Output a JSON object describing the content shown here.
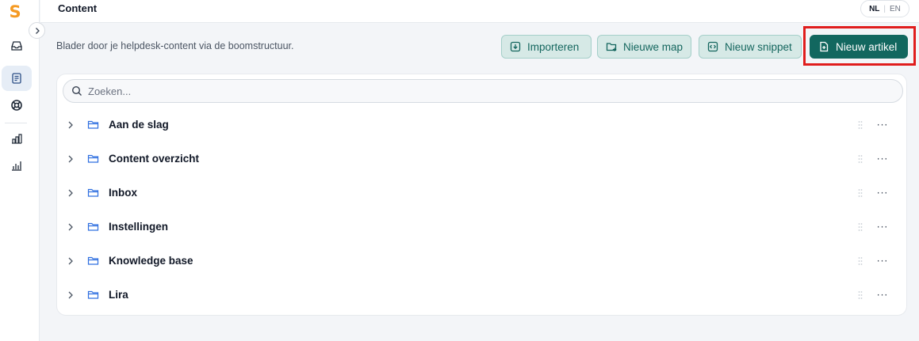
{
  "app": {
    "logo_letter": "S"
  },
  "sidebar": {
    "items": [
      {
        "name": "inbox",
        "icon": "inbox-icon"
      },
      {
        "name": "content",
        "icon": "document-icon",
        "active": true
      },
      {
        "name": "support",
        "icon": "lifebuoy-icon"
      },
      {
        "name": "reports",
        "icon": "building-chart-icon"
      },
      {
        "name": "analytics",
        "icon": "bar-chart-icon"
      }
    ]
  },
  "header": {
    "title": "Content",
    "lang": {
      "active": "NL",
      "other": "EN",
      "divider": "|"
    }
  },
  "toolbar": {
    "subtitle": "Blader door je helpdesk-content via de boomstructuur.",
    "import_label": "Importeren",
    "new_folder_label": "Nieuwe map",
    "new_snippet_label": "Nieuw snippet",
    "new_article_label": "Nieuw artikel"
  },
  "search": {
    "placeholder": "Zoeken..."
  },
  "tree": {
    "items": [
      {
        "label": "Aan de slag"
      },
      {
        "label": "Content overzicht"
      },
      {
        "label": "Inbox"
      },
      {
        "label": "Instellingen"
      },
      {
        "label": "Knowledge base"
      },
      {
        "label": "Lira"
      }
    ],
    "more_glyph": "···"
  },
  "colors": {
    "brand": "#f59a23",
    "primary": "#12675f",
    "secondary_bg": "#d6e9e6",
    "folder": "#2f6fe0",
    "highlight": "#e01d1d"
  }
}
